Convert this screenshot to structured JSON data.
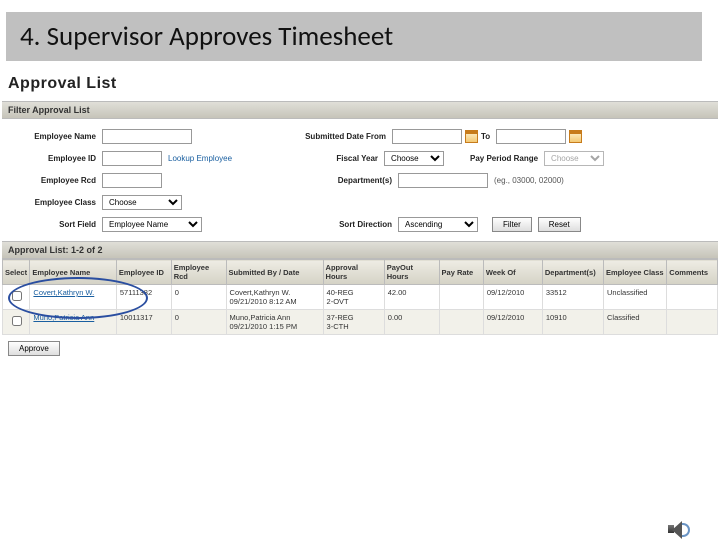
{
  "slide": {
    "title": "4.  Supervisor Approves Timesheet"
  },
  "page": {
    "title": "Approval List"
  },
  "filterBar": {
    "title": "Filter Approval List"
  },
  "filters": {
    "employeeName": {
      "label": "Employee Name"
    },
    "submittedFrom": {
      "label": "Submitted Date From",
      "to": "To"
    },
    "employeeId": {
      "label": "Employee ID",
      "lookup": "Lookup Employee"
    },
    "fiscalYear": {
      "label": "Fiscal Year",
      "value": "Choose"
    },
    "payPeriod": {
      "label": "Pay Period Range",
      "value": "Choose"
    },
    "employeeRcd": {
      "label": "Employee Rcd"
    },
    "departments": {
      "label": "Department(s)",
      "hint": "(eg., 03000, 02000)"
    },
    "employeeClass": {
      "label": "Employee Class",
      "value": "Choose"
    },
    "sortField": {
      "label": "Sort Field",
      "value": "Employee Name"
    },
    "sortDirection": {
      "label": "Sort Direction",
      "value": "Ascending"
    },
    "filterBtn": "Filter",
    "resetBtn": "Reset"
  },
  "results": {
    "title": "Approval List: 1-2 of 2"
  },
  "columns": {
    "select": "Select",
    "empName": "Employee Name",
    "empId": "Employee ID",
    "empRcd": "Employee Rcd",
    "submitted": "Submitted By / Date",
    "approvalHours": "Approval Hours",
    "payoutHours": "PayOut Hours",
    "payRate": "Pay Rate",
    "weekOf": "Week Of",
    "depts": "Department(s)",
    "empClass": "Employee Class",
    "comments": "Comments"
  },
  "rows": [
    {
      "empName": "Covert,Kathryn W.",
      "empId": "57111382",
      "empRcd": "0",
      "submitted": "Covert,Kathryn W.\n09/21/2010 8:12 AM",
      "approvalHours": "40-REG\n2-OVT",
      "payoutHours": "42.00",
      "payRate": "",
      "weekOf": "09/12/2010",
      "depts": "33512",
      "empClass": "Unclassified",
      "comments": ""
    },
    {
      "empName": "Muno,Patricia Ann",
      "empId": "10011317",
      "empRcd": "0",
      "submitted": "Muno,Patricia Ann\n09/21/2010 1:15 PM",
      "approvalHours": "37-REG\n3-CTH",
      "payoutHours": "0.00",
      "payRate": "",
      "weekOf": "09/12/2010",
      "depts": "10910",
      "empClass": "Classified",
      "comments": ""
    }
  ],
  "approveBtn": "Approve"
}
